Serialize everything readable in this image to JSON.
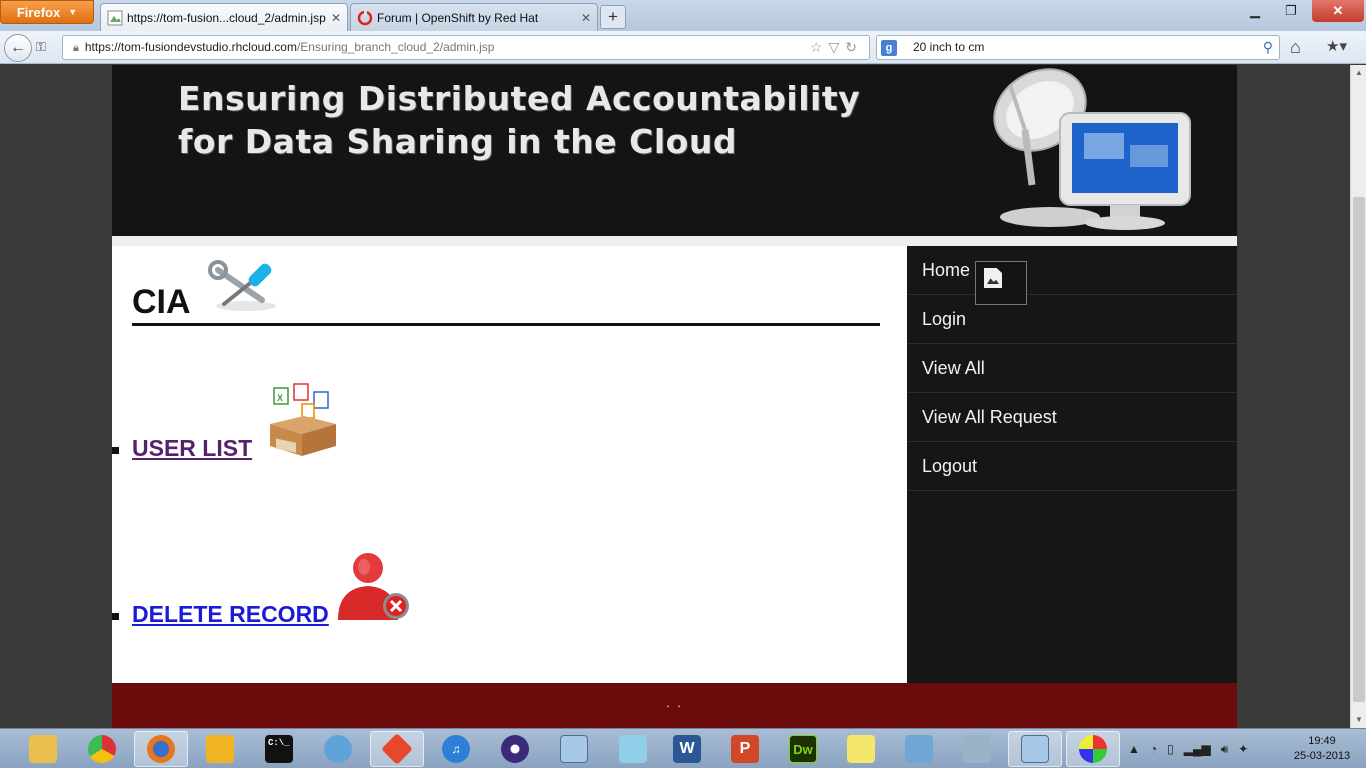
{
  "browser": {
    "menu_label": "Firefox",
    "tabs": [
      {
        "label": "https://tom-fusion...cloud_2/admin.jsp",
        "active": true
      },
      {
        "label": "Forum | OpenShift by Red Hat",
        "active": false
      }
    ],
    "new_tab_label": "+",
    "url": {
      "host": "https://tom-fusiondevstudio.rhcloud.com",
      "path": "/Ensuring_branch_cloud_2/admin.jsp"
    },
    "search_query": "20 inch to cm"
  },
  "page": {
    "banner_title_line1": "Ensuring Distributed Accountability",
    "banner_title_line2": "for Data Sharing in the Cloud",
    "heading": "CIA",
    "links": [
      {
        "label": "USER LIST",
        "state": "visited"
      },
      {
        "label": "DELETE RECORD",
        "state": "unvisited"
      }
    ],
    "sidebar_nav": [
      "Home",
      "Login",
      "View All",
      "View All Request",
      "Logout"
    ],
    "footer_text": ". ."
  },
  "taskbar": {
    "apps": [
      {
        "name": "explorer",
        "icon": "folder-icon",
        "label": ""
      },
      {
        "name": "chrome",
        "icon": "chrome-icon",
        "label": ""
      },
      {
        "name": "firefox",
        "icon": "firefox-icon",
        "label": "",
        "active": true
      },
      {
        "name": "puzzle-app",
        "icon": "puzzle-icon",
        "label": ""
      },
      {
        "name": "command-prompt",
        "icon": "cmd-icon",
        "label": "C:\\_"
      },
      {
        "name": "app-circle",
        "icon": "app-icon",
        "label": ""
      },
      {
        "name": "git",
        "icon": "git-icon",
        "label": "",
        "active": true
      },
      {
        "name": "itunes",
        "icon": "itunes-icon",
        "label": "♫"
      },
      {
        "name": "eclipse",
        "icon": "eclipse-icon",
        "label": ""
      },
      {
        "name": "virtualbox",
        "icon": "cube-icon",
        "label": ""
      },
      {
        "name": "notepad",
        "icon": "notepad-icon",
        "label": ""
      },
      {
        "name": "word",
        "icon": "word-icon",
        "label": "W"
      },
      {
        "name": "powerpoint",
        "icon": "powerpoint-icon",
        "label": "P"
      },
      {
        "name": "dreamweaver",
        "icon": "dreamweaver-icon",
        "label": "Dw"
      },
      {
        "name": "sticky-notes",
        "icon": "notes-icon",
        "label": ""
      },
      {
        "name": "control-panel",
        "icon": "control-panel-icon",
        "label": ""
      },
      {
        "name": "task-manager",
        "icon": "monitor-icon",
        "label": ""
      },
      {
        "name": "virtualbox-2",
        "icon": "cube-icon",
        "label": "",
        "active": true
      },
      {
        "name": "paint",
        "icon": "paint-icon",
        "label": "",
        "active": true
      }
    ],
    "clock_time": "19:49",
    "clock_date": "25-03-2013"
  },
  "colors": {
    "banner_bg": "#141414",
    "sidebar_bg": "#161616",
    "footer_bg": "#6b0b0b",
    "visited_link": "#55226e",
    "unvisited_link": "#1a1ad8"
  }
}
